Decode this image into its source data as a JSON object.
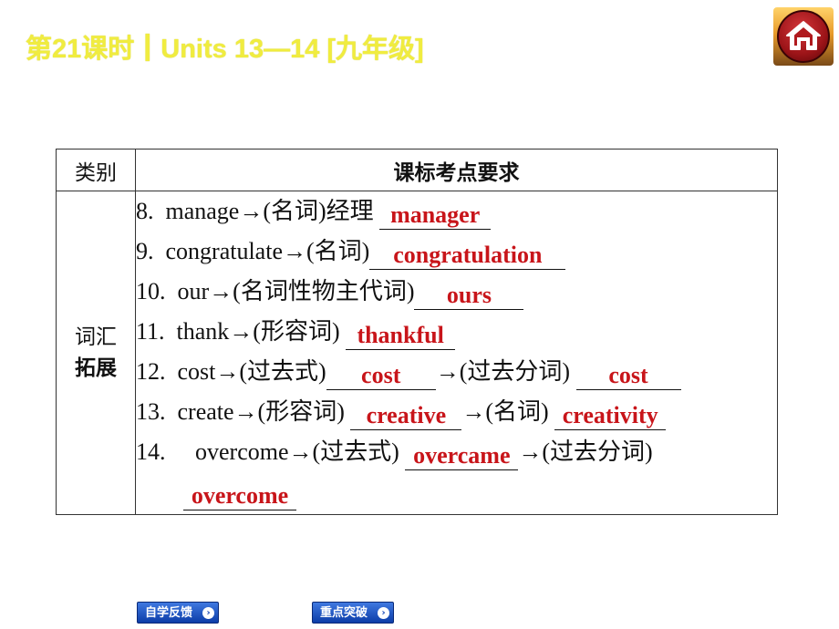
{
  "header": {
    "title": "第21课时┃Units 13—14 [九年级]"
  },
  "home_button": {
    "icon": "home-icon"
  },
  "table": {
    "col_category": "类别",
    "col_requirement": "课标考点要求",
    "category": {
      "line1": "词汇",
      "line2": "拓展"
    },
    "items": [
      {
        "num": "8.",
        "word": "manage→(名词)经理",
        "answer": "manager"
      },
      {
        "num": "9.",
        "word": "congratulate→(名词)",
        "answer": "congratulation"
      },
      {
        "num": "10.",
        "word": "our→(名词性物主代词)",
        "answer": "ours"
      },
      {
        "num": "11.",
        "word": "thank→(形容词)",
        "answer": "thankful"
      },
      {
        "num": "12.",
        "word": "cost→(过去式)",
        "answer": "cost",
        "word2": "→(过去分词)",
        "answer2": "cost"
      },
      {
        "num": "13.",
        "word": "create→(形容词)",
        "answer": "creative",
        "word2": "→(名词)",
        "answer2": "creativity"
      },
      {
        "num": "14.",
        "word": "overcome→(过去式)",
        "answer": "overcame",
        "word2": "→(过去分词)",
        "answer2": "overcome"
      }
    ]
  },
  "nav": {
    "self_study": "自学反馈",
    "key_points": "重点突破"
  }
}
